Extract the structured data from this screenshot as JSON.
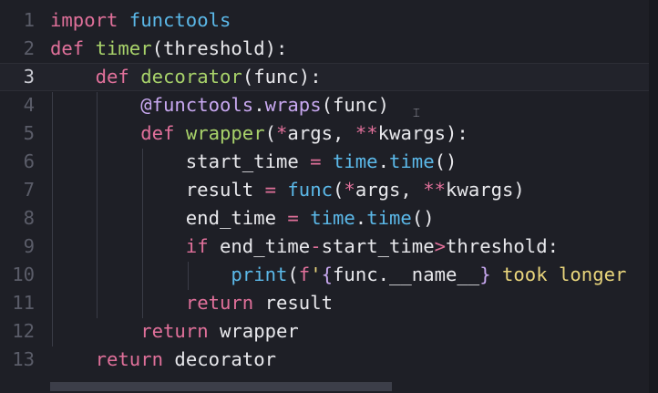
{
  "editor": {
    "language": "python",
    "current_line": 3,
    "lines": [
      {
        "n": "1",
        "tokens": [
          {
            "t": "import",
            "c": "kw"
          },
          {
            "t": " functools",
            "c": "bi"
          }
        ]
      },
      {
        "n": "2",
        "tokens": [
          {
            "t": "def",
            "c": "kw"
          },
          {
            "t": " ",
            "c": "var"
          },
          {
            "t": "timer",
            "c": "fn"
          },
          {
            "t": "(threshold):",
            "c": "var"
          }
        ]
      },
      {
        "n": "3",
        "tokens": [
          {
            "t": "    ",
            "c": "var"
          },
          {
            "t": "def",
            "c": "kw"
          },
          {
            "t": " ",
            "c": "var"
          },
          {
            "t": "decorator",
            "c": "fn"
          },
          {
            "t": "(func):",
            "c": "var"
          }
        ]
      },
      {
        "n": "4",
        "tokens": [
          {
            "t": "        ",
            "c": "var"
          },
          {
            "t": "@functools",
            "c": "dec"
          },
          {
            "t": ".",
            "c": "var"
          },
          {
            "t": "wraps",
            "c": "dec"
          },
          {
            "t": "(func)",
            "c": "var"
          }
        ]
      },
      {
        "n": "5",
        "tokens": [
          {
            "t": "        ",
            "c": "var"
          },
          {
            "t": "def",
            "c": "kw"
          },
          {
            "t": " ",
            "c": "var"
          },
          {
            "t": "wrapper",
            "c": "fn"
          },
          {
            "t": "(",
            "c": "var"
          },
          {
            "t": "*",
            "c": "op"
          },
          {
            "t": "args, ",
            "c": "var"
          },
          {
            "t": "**",
            "c": "op"
          },
          {
            "t": "kwargs):",
            "c": "var"
          }
        ]
      },
      {
        "n": "6",
        "tokens": [
          {
            "t": "            start_time ",
            "c": "var"
          },
          {
            "t": "=",
            "c": "op"
          },
          {
            "t": " ",
            "c": "var"
          },
          {
            "t": "time",
            "c": "bi"
          },
          {
            "t": ".",
            "c": "var"
          },
          {
            "t": "time",
            "c": "bi"
          },
          {
            "t": "()",
            "c": "var"
          }
        ]
      },
      {
        "n": "7",
        "tokens": [
          {
            "t": "            result ",
            "c": "var"
          },
          {
            "t": "=",
            "c": "op"
          },
          {
            "t": " ",
            "c": "var"
          },
          {
            "t": "func",
            "c": "bi"
          },
          {
            "t": "(",
            "c": "var"
          },
          {
            "t": "*",
            "c": "op"
          },
          {
            "t": "args, ",
            "c": "var"
          },
          {
            "t": "**",
            "c": "op"
          },
          {
            "t": "kwargs)",
            "c": "var"
          }
        ]
      },
      {
        "n": "8",
        "tokens": [
          {
            "t": "            end_time ",
            "c": "var"
          },
          {
            "t": "=",
            "c": "op"
          },
          {
            "t": " ",
            "c": "var"
          },
          {
            "t": "time",
            "c": "bi"
          },
          {
            "t": ".",
            "c": "var"
          },
          {
            "t": "time",
            "c": "bi"
          },
          {
            "t": "()",
            "c": "var"
          }
        ]
      },
      {
        "n": "9",
        "tokens": [
          {
            "t": "            ",
            "c": "var"
          },
          {
            "t": "if",
            "c": "kw"
          },
          {
            "t": " end_time",
            "c": "var"
          },
          {
            "t": "-",
            "c": "op"
          },
          {
            "t": "start_time",
            "c": "var"
          },
          {
            "t": ">",
            "c": "op"
          },
          {
            "t": "threshold:",
            "c": "var"
          }
        ]
      },
      {
        "n": "10",
        "tokens": [
          {
            "t": "                ",
            "c": "var"
          },
          {
            "t": "print",
            "c": "bi"
          },
          {
            "t": "(",
            "c": "var"
          },
          {
            "t": "f",
            "c": "kw"
          },
          {
            "t": "'",
            "c": "str"
          },
          {
            "t": "{",
            "c": "brace"
          },
          {
            "t": "func.__name__",
            "c": "var"
          },
          {
            "t": "}",
            "c": "brace"
          },
          {
            "t": " took longer",
            "c": "str"
          }
        ]
      },
      {
        "n": "11",
        "tokens": [
          {
            "t": "            ",
            "c": "var"
          },
          {
            "t": "return",
            "c": "kw"
          },
          {
            "t": " result",
            "c": "var"
          }
        ]
      },
      {
        "n": "12",
        "tokens": [
          {
            "t": "        ",
            "c": "var"
          },
          {
            "t": "return",
            "c": "kw"
          },
          {
            "t": " wrapper",
            "c": "var"
          }
        ]
      },
      {
        "n": "13",
        "tokens": [
          {
            "t": "    ",
            "c": "var"
          },
          {
            "t": "return",
            "c": "kw"
          },
          {
            "t": " decorator",
            "c": "var"
          }
        ]
      }
    ]
  },
  "colors": {
    "background": "#1e1f26",
    "keyword": "#e0709a",
    "function_name": "#a8d26a",
    "builtin": "#5bb8e8",
    "decorator": "#c8a8f0",
    "string": "#e9d57c"
  },
  "icons": {
    "mouse_cursor": "text-cursor-icon"
  }
}
